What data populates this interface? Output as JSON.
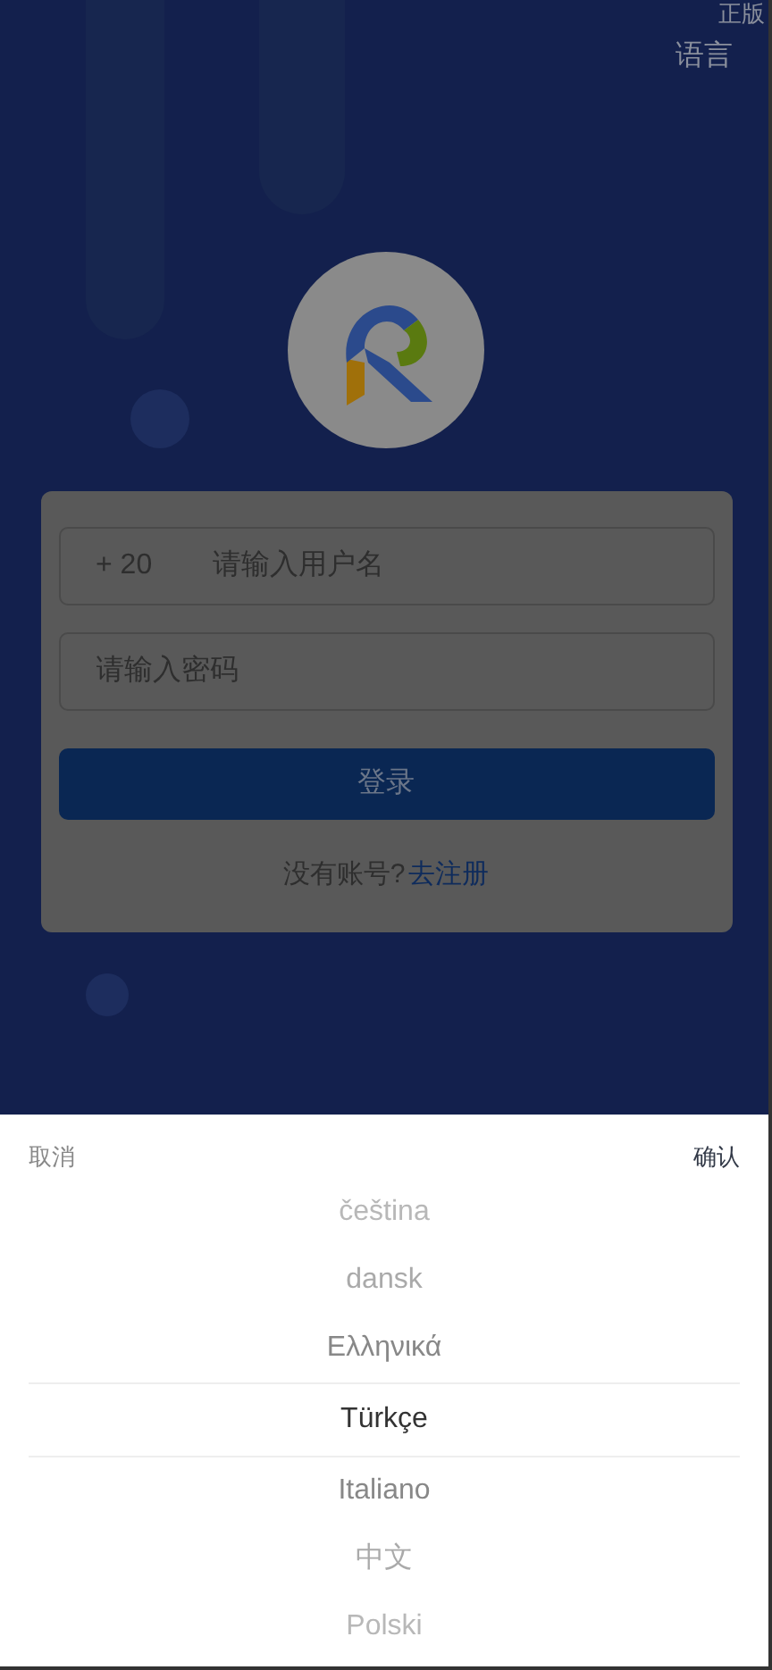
{
  "corner_badge": "正版",
  "language_button": "语言",
  "login_form": {
    "country_code": "+ 20",
    "username_placeholder": "请输入用户名",
    "password_placeholder": "请输入密码",
    "login_button": "登录",
    "register_prompt": "没有账号?",
    "register_link": "去注册"
  },
  "language_picker": {
    "cancel": "取消",
    "confirm": "确认",
    "options": [
      {
        "label": "čeština",
        "selected": false
      },
      {
        "label": "dansk",
        "selected": false
      },
      {
        "label": "Ελληνικά",
        "selected": false
      },
      {
        "label": "Türkçe",
        "selected": true
      },
      {
        "label": "Italiano",
        "selected": false
      },
      {
        "label": "中文",
        "selected": false
      },
      {
        "label": "Polski",
        "selected": false
      }
    ]
  }
}
